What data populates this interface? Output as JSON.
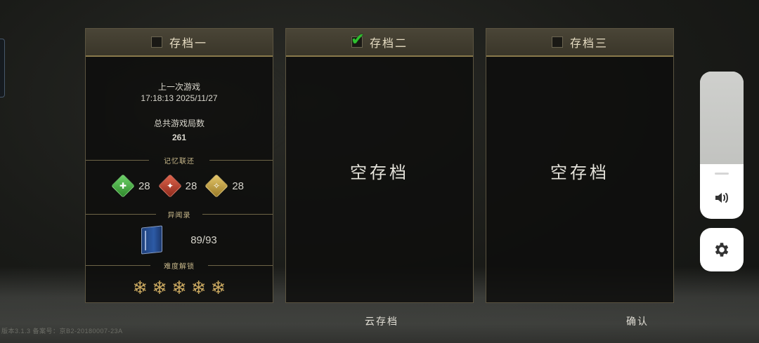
{
  "slots": [
    {
      "title": "存档一",
      "checked": false,
      "last_play_label": "上一次游戏",
      "last_play_time": "17:18:13 2025/11/27",
      "total_games_label": "总共游戏局数",
      "total_games": "261",
      "memory_section": "记忆联还",
      "memory_stats": [
        {
          "icon": "green-heart-gem-icon",
          "value": "28"
        },
        {
          "icon": "red-sword-gem-icon",
          "value": "28"
        },
        {
          "icon": "gold-gem-icon",
          "value": "28"
        }
      ],
      "records_section": "异闻录",
      "records_value": "89/93",
      "difficulty_section": "难度解锁",
      "difficulty_unlocked": 5
    },
    {
      "title": "存档二",
      "checked": true,
      "empty_label": "空存档"
    },
    {
      "title": "存档三",
      "checked": false,
      "empty_label": "空存档"
    }
  ],
  "buttons": {
    "cloud_save": "云存档",
    "confirm": "确认"
  },
  "version_text": "版本3.1.3  备案号：京B2-20180007-23A",
  "colors": {
    "accent_gold": "#c9a860",
    "check_green": "#2fbf2f",
    "panel_border": "#5b5440"
  },
  "volume_level": 0.37
}
